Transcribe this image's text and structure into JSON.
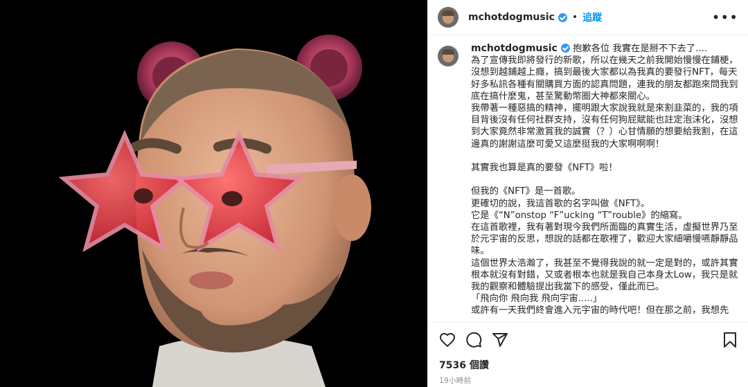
{
  "post": {
    "username": "mchotdogmusic",
    "follow_label": "追蹤",
    "separator": "•",
    "more_label": "•••"
  },
  "caption": {
    "username": "mchotdogmusic",
    "lines": [
      "抱歉各位 我實在是掰不下去了....",
      "為了宣傳我即將發行的新歌，所以在幾天之前我開始慢慢在鋪梗，沒想到越鋪越上癮，搞到最後大家都以為我真的要發行NFT，每天好多私訊各種有關購買方面的認真問題，連我的朋友都跑來問我到底在搞什麼鬼，甚至驚動幣圈大神都來關心。",
      "我帶著一種惡搞的精神，擺明跟大家說我就是來割韭菜的，我的項目背後沒有任何社群支持，沒有任何狗屁賦能也註定泡沫化，沒想到大家竟然非常激賞我的誠實（？）心甘情願的想要給我割，在這邊真的謝謝這麼可愛又這麼挺我的大家啊啊啊！",
      "",
      "其實我也算是真的要發《NFT》啦！",
      "",
      "但我的《NFT》是一首歌。",
      "更確切的說，我這首歌的名字叫做《NFT》。",
      "它是《“N”onstop “F”ucking “T”rouble》的縮寫。",
      "在這首歌裡，我有著對現今我們所面臨的真實生活，虛擬世界乃至於元宇宙的反思，想說的話都在歌裡了，歡迎大家細嚼慢嚥靜靜品味。",
      "這個世界太浩瀚了，我甚至不覺得我說的就一定是對的，或許其實根本就沒有對錯，又或者根本也就是我自己本身太Low，我只是就我的觀察和體驗提出我當下的感受，僅此而已。",
      "「飛向你 飛向我 飛向宇宙.....」",
      "或許有一天我們終會進入元宇宙的時代吧！但在那之前，我想先"
    ]
  },
  "stats": {
    "likes": "7536 個讚",
    "time": "19小時前"
  },
  "colors": {
    "accent": "#0095f6",
    "verified": "#3897f0",
    "text": "#262626",
    "muted": "#8e8e8e"
  },
  "icons": [
    "heart-icon",
    "comment-icon",
    "share-icon",
    "bookmark-icon",
    "verified-badge-icon",
    "more-options-icon"
  ]
}
